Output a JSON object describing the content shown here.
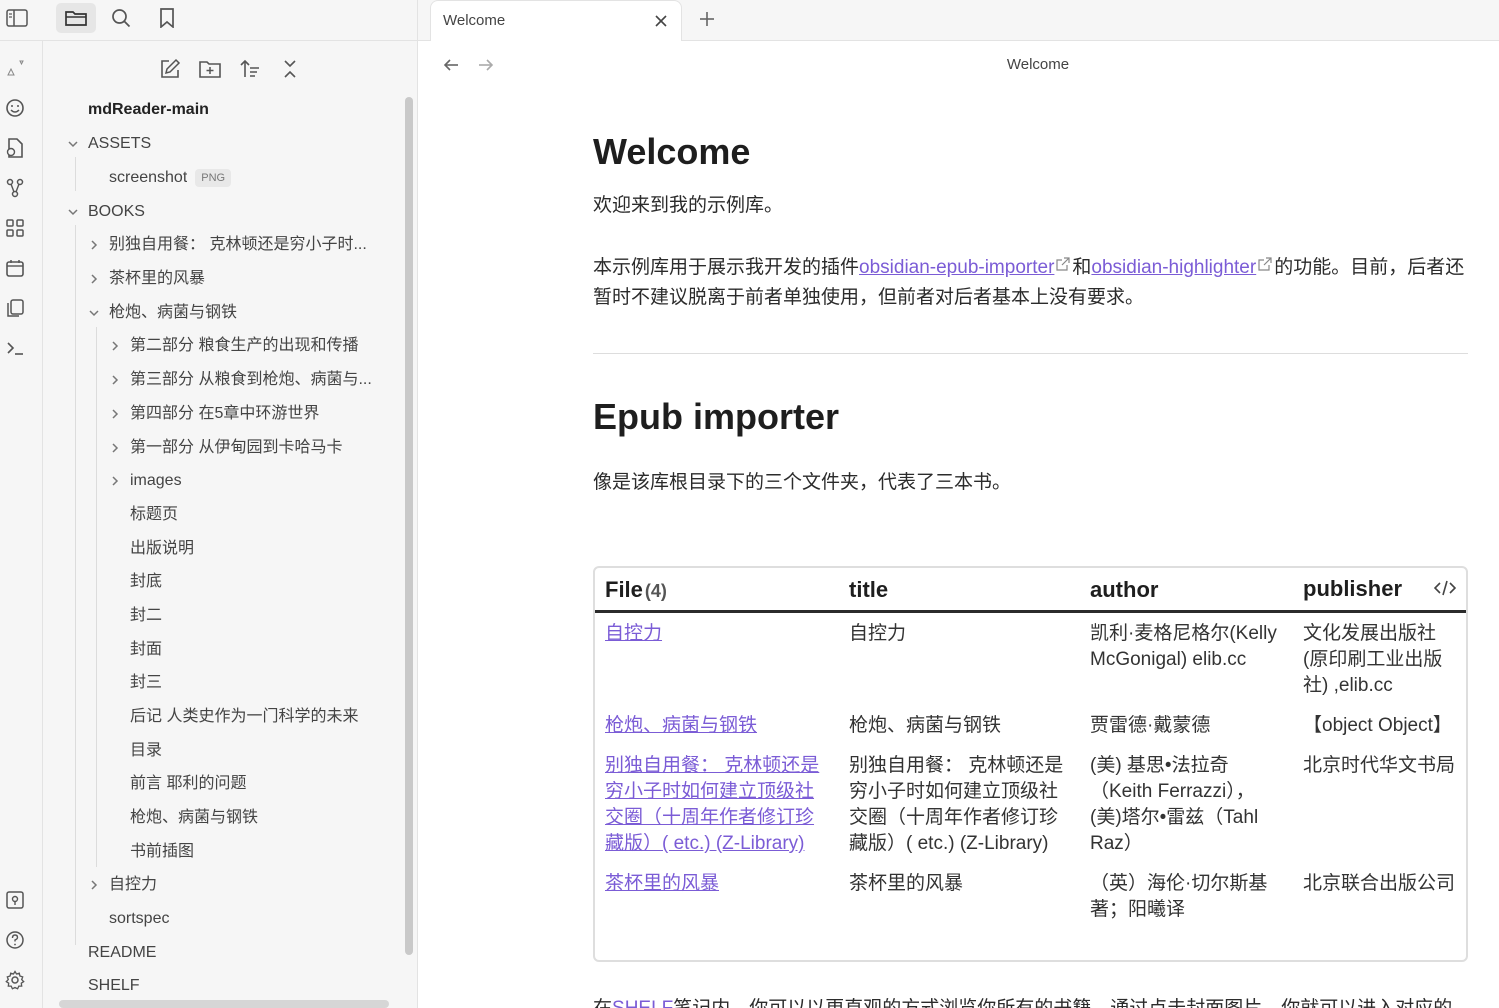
{
  "top_toolbar": {
    "icons": [
      "sidebar-toggle-icon",
      "folder-icon",
      "search-icon",
      "bookmark-icon"
    ]
  },
  "ribbon": {
    "icons": [
      "vault-switch-icon",
      "smiley-icon",
      "file-plus-icon",
      "graph-icon",
      "grid-icon",
      "calendar-icon",
      "copy-icon",
      "terminal-icon",
      "help-vault-icon",
      "help-icon",
      "settings-icon"
    ]
  },
  "explorer": {
    "actions": [
      "new-note-icon",
      "new-folder-icon",
      "sort-icon",
      "collapse-icon"
    ],
    "root": "mdReader-main",
    "items": {
      "assets": "ASSETS",
      "screenshot": "screenshot",
      "screenshot_badge": "PNG",
      "books": "BOOKS",
      "book1": "别独自用餐： 克林顿还是穷小子时...",
      "book2": "茶杯里的风暴",
      "book3": "枪炮、病菌与钢铁",
      "ch2": "第二部分 粮食生产的出现和传播",
      "ch3": "第三部分 从粮食到枪炮、病菌与...",
      "ch4": "第四部分 在5章中环游世界",
      "ch1": "第一部分 从伊甸园到卡哈马卡",
      "images": "images",
      "title_page": "标题页",
      "pub_note": "出版说明",
      "back_cover": "封底",
      "cover2": "封二",
      "cover": "封面",
      "cover3": "封三",
      "afterword": "后记 人类史作为一门科学的未来",
      "toc": "目录",
      "preface": "前言 耶利的问题",
      "book3_note": "枪炮、病菌与钢铁",
      "front_illus": "书前插图",
      "book4": "自控力",
      "sortspec": "sortspec",
      "readme": "README",
      "shelf": "SHELF"
    }
  },
  "tab": {
    "title": "Welcome"
  },
  "view": {
    "title": "Welcome"
  },
  "doc": {
    "h1": "Welcome",
    "intro": "欢迎来到我的示例库。",
    "p2_a": "本示例库用于展示我开发的插件",
    "link1": "obsidian-epub-importer",
    "p2_b": "和",
    "link2": "obsidian-highlighter",
    "p2_c": "的功能。目前，后者还暂时不建议脱离于前者单独使用，但前者对后者基本上没有要求。",
    "h2": "Epub importer",
    "p3": "像是该库根目录下的三个文件夹，代表了三本书。",
    "p4_a": "在",
    "p4_link": "SHELF",
    "p4_b": "笔记内，你可以以更直观的方式浏览你所有的书籍，通过点击封面图片，你就可以进入对应的书籍页面，就像这样："
  },
  "table": {
    "headers": {
      "file": "File",
      "file_count": "(4)",
      "title": "title",
      "author": "author",
      "publisher": "publisher"
    },
    "rows": [
      {
        "file": "自控力",
        "title": "自控力",
        "author": "凯利·麦格尼格尔(Kelly McGonigal) elib.cc",
        "publisher": "文化发展出版社(原印刷工业出版社) ,elib.cc"
      },
      {
        "file": "枪炮、病菌与钢铁",
        "title": "枪炮、病菌与钢铁",
        "author": "贾雷德·戴蒙德",
        "publisher": "【object Object】"
      },
      {
        "file": "别独自用餐： 克林顿还是穷小子时如何建立顶级社交圈（十周年作者修订珍藏版）( etc.) (Z-Library)",
        "title": "别独自用餐： 克林顿还是穷小子时如何建立顶级社交圈（十周年作者修订珍藏版）( etc.) (Z-Library)",
        "author": "(美) 基思•法拉奇（Keith Ferrazzi），(美)塔尔•雷兹（Tahl Raz）",
        "publisher": "北京时代华文书局"
      },
      {
        "file": "茶杯里的风暴",
        "title": "茶杯里的风暴",
        "author": "（英）海伦·切尔斯基著；阳曦译",
        "publisher": "北京联合出版公司"
      }
    ]
  },
  "colors": {
    "accent": "#7b5cd6",
    "sidebar_bg": "#f6f6f6"
  }
}
